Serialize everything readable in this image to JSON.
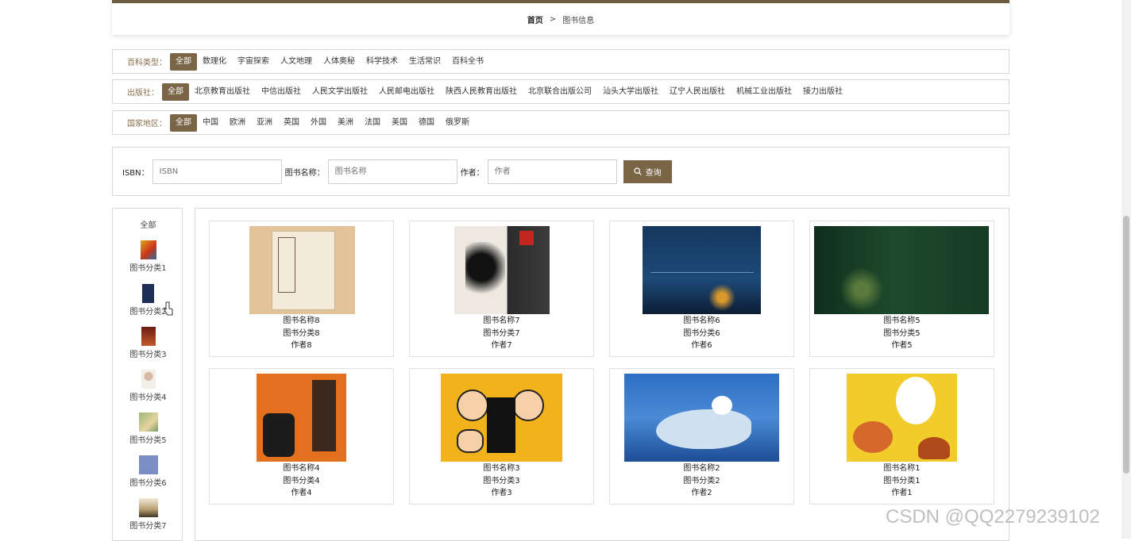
{
  "breadcrumb": {
    "home": "首页",
    "separator": ">",
    "current": "图书信息"
  },
  "filters": {
    "encyclopedia": {
      "label": "百科类型：",
      "options": [
        "全部",
        "数理化",
        "宇宙探索",
        "人文地理",
        "人体奥秘",
        "科学技术",
        "生活常识",
        "百科全书"
      ],
      "active": "全部"
    },
    "publisher": {
      "label": "出版社：",
      "options": [
        "全部",
        "北京教育出版社",
        "中信出版社",
        "人民文学出版社",
        "人民邮电出版社",
        "陕西人民教育出版社",
        "北京联合出版公司",
        "汕头大学出版社",
        "辽宁人民出版社",
        "机械工业出版社",
        "接力出版社"
      ],
      "active": "全部"
    },
    "region": {
      "label": "国家地区：",
      "options": [
        "全部",
        "中国",
        "欧洲",
        "亚洲",
        "英国",
        "外国",
        "美洲",
        "法国",
        "美国",
        "德国",
        "俄罗斯"
      ],
      "active": "全部"
    }
  },
  "search": {
    "isbn_label": "ISBN：",
    "isbn_placeholder": "ISBN",
    "name_label": "图书名称：",
    "name_placeholder": "图书名称",
    "author_label": "作者：",
    "author_placeholder": "作者",
    "button": "查询"
  },
  "sidebar": {
    "all": "全部",
    "categories": [
      "图书分类1",
      "图书分类2",
      "图书分类3",
      "图书分类4",
      "图书分类5",
      "图书分类6",
      "图书分类7"
    ]
  },
  "books": [
    {
      "name": "图书名称8",
      "category": "图书分类8",
      "author": "作者8"
    },
    {
      "name": "图书名称7",
      "category": "图书分类7",
      "author": "作者7"
    },
    {
      "name": "图书名称6",
      "category": "图书分类6",
      "author": "作者6"
    },
    {
      "name": "图书名称5",
      "category": "图书分类5",
      "author": "作者5"
    },
    {
      "name": "图书名称4",
      "category": "图书分类4",
      "author": "作者4"
    },
    {
      "name": "图书名称3",
      "category": "图书分类3",
      "author": "作者3"
    },
    {
      "name": "图书名称2",
      "category": "图书分类2",
      "author": "作者2"
    },
    {
      "name": "图书名称1",
      "category": "图书分类1",
      "author": "作者1"
    }
  ],
  "watermark": "CSDN @QQ2279239102",
  "colors": {
    "accent": "#7a6547",
    "border": "#d8d8d8"
  }
}
